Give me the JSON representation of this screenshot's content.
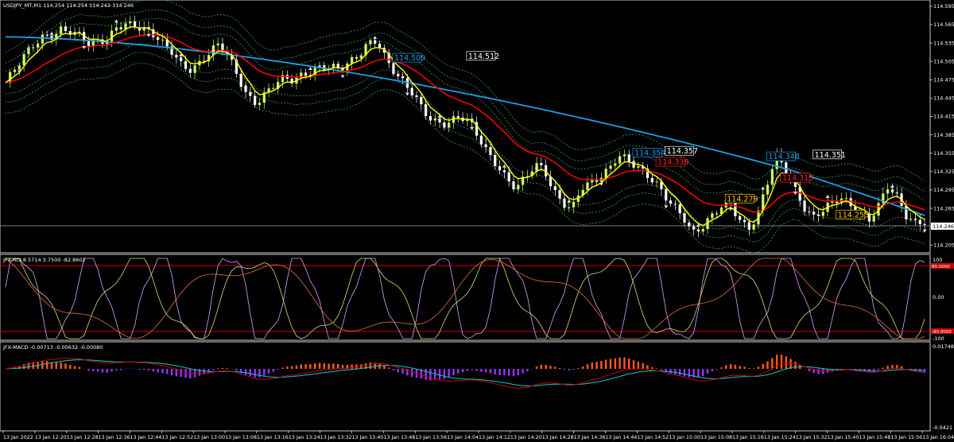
{
  "window": {
    "main_title": "USDJPY_MT,M1  114.254 114.254 114.243 114.246",
    "rci_title": "JFX-RCI 8.5714 3.7500 -82.8602",
    "macd_title": "JFX-MACD -0.00713 -0.00632 -0.00080"
  },
  "colors": {
    "background": "#000000",
    "axis": "#ffffff",
    "bull_candle": "#ccff66",
    "bear_candle": "#ffffff",
    "ma_fast": "#ffff00",
    "ma_mid": "#ff0000",
    "ma_slow": "#1e9fe6",
    "bands": "#3cb371",
    "rci_level": "#cc0000",
    "macd_pos": "#ff5a1a",
    "macd_neg": "#9933ff",
    "macd_signal": "#00cccc",
    "macd_line": "#cc0000"
  },
  "price_axis": {
    "ticks": [
      "114.595",
      "114.565",
      "114.535",
      "114.505",
      "114.475",
      "114.445",
      "114.415",
      "114.385",
      "114.355",
      "114.325",
      "114.295",
      "114.265",
      "114.235",
      "114.205"
    ],
    "current_price": "114.246",
    "range": [
      114.195,
      114.6
    ]
  },
  "rci_axis": {
    "ticks": [
      "100",
      "0.00",
      "-100"
    ],
    "levels": [
      "80.0000",
      "-80.0000"
    ]
  },
  "macd_axis": {
    "ticks": [
      "0.01748",
      "-0.0421"
    ]
  },
  "time_axis": [
    "13 Jan 2022",
    "13 Jan 12:20",
    "13 Jan 12:28",
    "13 Jan 12:36",
    "13 Jan 12:44",
    "13 Jan 12:52",
    "13 Jan 13:00",
    "13 Jan 13:08",
    "13 Jan 13:16",
    "13 Jan 13:24",
    "13 Jan 13:32",
    "13 Jan 13:40",
    "13 Jan 13:48",
    "13 Jan 13:56",
    "13 Jan 14:04",
    "13 Jan 14:12",
    "13 Jan 14:20",
    "13 Jan 14:28",
    "13 Jan 14:36",
    "13 Jan 14:44",
    "13 Jan 14:52",
    "13 Jan 15:00",
    "13 Jan 15:08",
    "13 Jan 15:16",
    "13 Jan 15:24",
    "13 Jan 15:32",
    "13 Jan 15:40",
    "13 Jan 15:48",
    "13 Jan 15:56",
    "13 Jan 16:04"
  ],
  "price_labels": [
    {
      "text": "114.509",
      "price": 114.509,
      "bar": 84,
      "color": "#1e9fe6"
    },
    {
      "text": "114.512",
      "price": 114.512,
      "bar": 100,
      "color": "#ffffff"
    },
    {
      "text": "114.354",
      "price": 114.354,
      "bar": 136,
      "color": "#1e9fe6"
    },
    {
      "text": "114.357",
      "price": 114.357,
      "bar": 143,
      "color": "#ffffff"
    },
    {
      "text": "114.339",
      "price": 114.339,
      "bar": 141,
      "color": "#ff2222"
    },
    {
      "text": "114.279",
      "price": 114.279,
      "bar": 156,
      "color": "#ffcc00"
    },
    {
      "text": "114.348",
      "price": 114.348,
      "bar": 165,
      "color": "#1e9fe6"
    },
    {
      "text": "114.351",
      "price": 114.351,
      "bar": 175,
      "color": "#ffffff"
    },
    {
      "text": "114.313",
      "price": 114.313,
      "bar": 168,
      "color": "#ff2222"
    },
    {
      "text": "114.253",
      "price": 114.253,
      "bar": 180,
      "color": "#ffcc00"
    }
  ],
  "chart_data": {
    "type": "line",
    "title": "USDJPY_MT,M1",
    "x_start": "13 Jan 2022 12:12",
    "x_end": "13 Jan 16:06",
    "series": [
      {
        "name": "price",
        "values": [
          114.47,
          114.49,
          114.51,
          114.53,
          114.545,
          114.55,
          114.56,
          114.555,
          114.545,
          114.53,
          114.535,
          114.54,
          114.565,
          114.57,
          114.565,
          114.555,
          114.545,
          114.53,
          114.52,
          114.5,
          114.495,
          114.505,
          114.52,
          114.53,
          114.51,
          114.48,
          114.45,
          114.44,
          114.455,
          114.47,
          114.475,
          114.47,
          114.48,
          114.49,
          114.5,
          114.5,
          114.495,
          114.5,
          114.51,
          114.53,
          114.54,
          114.51,
          114.49,
          114.47,
          114.45,
          114.42,
          114.405,
          114.4,
          114.41,
          114.42,
          114.41,
          114.38,
          114.35,
          114.33,
          114.31,
          114.3,
          114.32,
          114.34,
          114.33,
          114.29,
          114.27,
          114.26,
          114.3,
          114.31,
          114.32,
          114.33,
          114.35,
          114.34,
          114.33,
          114.32,
          114.31,
          114.29,
          114.27,
          114.25,
          114.22,
          114.23,
          114.25,
          114.27,
          114.28,
          114.25,
          114.23,
          114.25,
          114.3,
          114.35,
          114.33,
          114.3,
          114.27,
          114.25,
          114.26,
          114.27,
          114.28,
          114.27,
          114.26,
          114.25,
          114.27,
          114.3,
          114.28,
          114.25,
          114.24,
          114.246
        ],
        "note_unit": "price"
      },
      {
        "name": "MA fast"
      },
      {
        "name": "MA mid"
      },
      {
        "name": "MA slow"
      }
    ],
    "ylim": [
      114.195,
      114.6
    ]
  }
}
